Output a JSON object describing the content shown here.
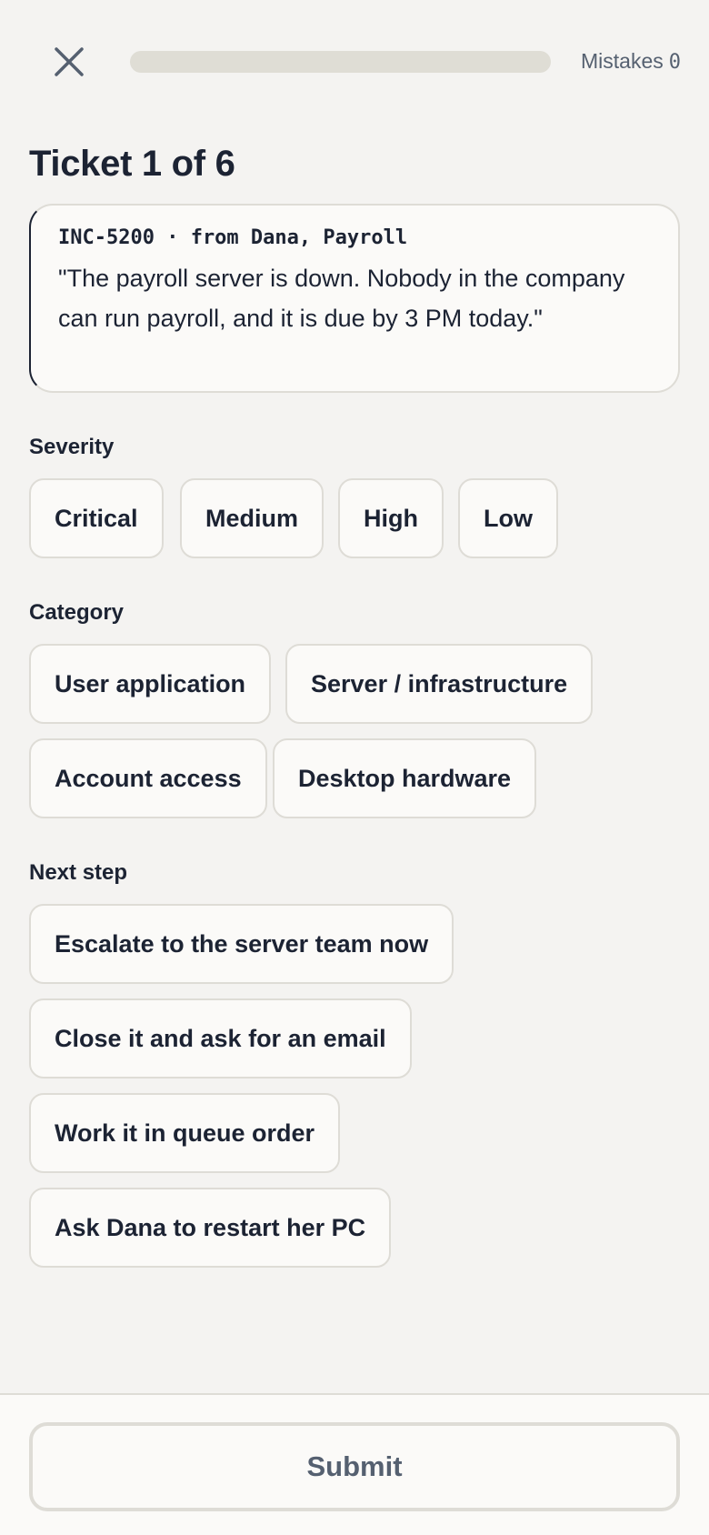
{
  "header": {
    "close_icon": "close-icon",
    "progress": 0,
    "mistakes_label": "Mistakes",
    "mistakes_count": "0"
  },
  "title": "Ticket 1 of 6",
  "ticket": {
    "meta": "INC-5200 · from Dana, Payroll",
    "body": "\"The payroll server is down. Nobody in the company can run payroll, and it is due by 3 PM today.\""
  },
  "severity": {
    "label": "Severity",
    "options": [
      "Critical",
      "Medium",
      "High",
      "Low"
    ]
  },
  "category": {
    "label": "Category",
    "options": [
      "User application",
      "Server / infrastructure",
      "Account access",
      "Desktop hardware"
    ]
  },
  "next_step": {
    "label": "Next step",
    "options": [
      "Escalate to the server team now",
      "Close it and ask for an email",
      "Work it in queue order",
      "Ask Dana to restart her PC"
    ]
  },
  "footer": {
    "submit_label": "Submit"
  }
}
